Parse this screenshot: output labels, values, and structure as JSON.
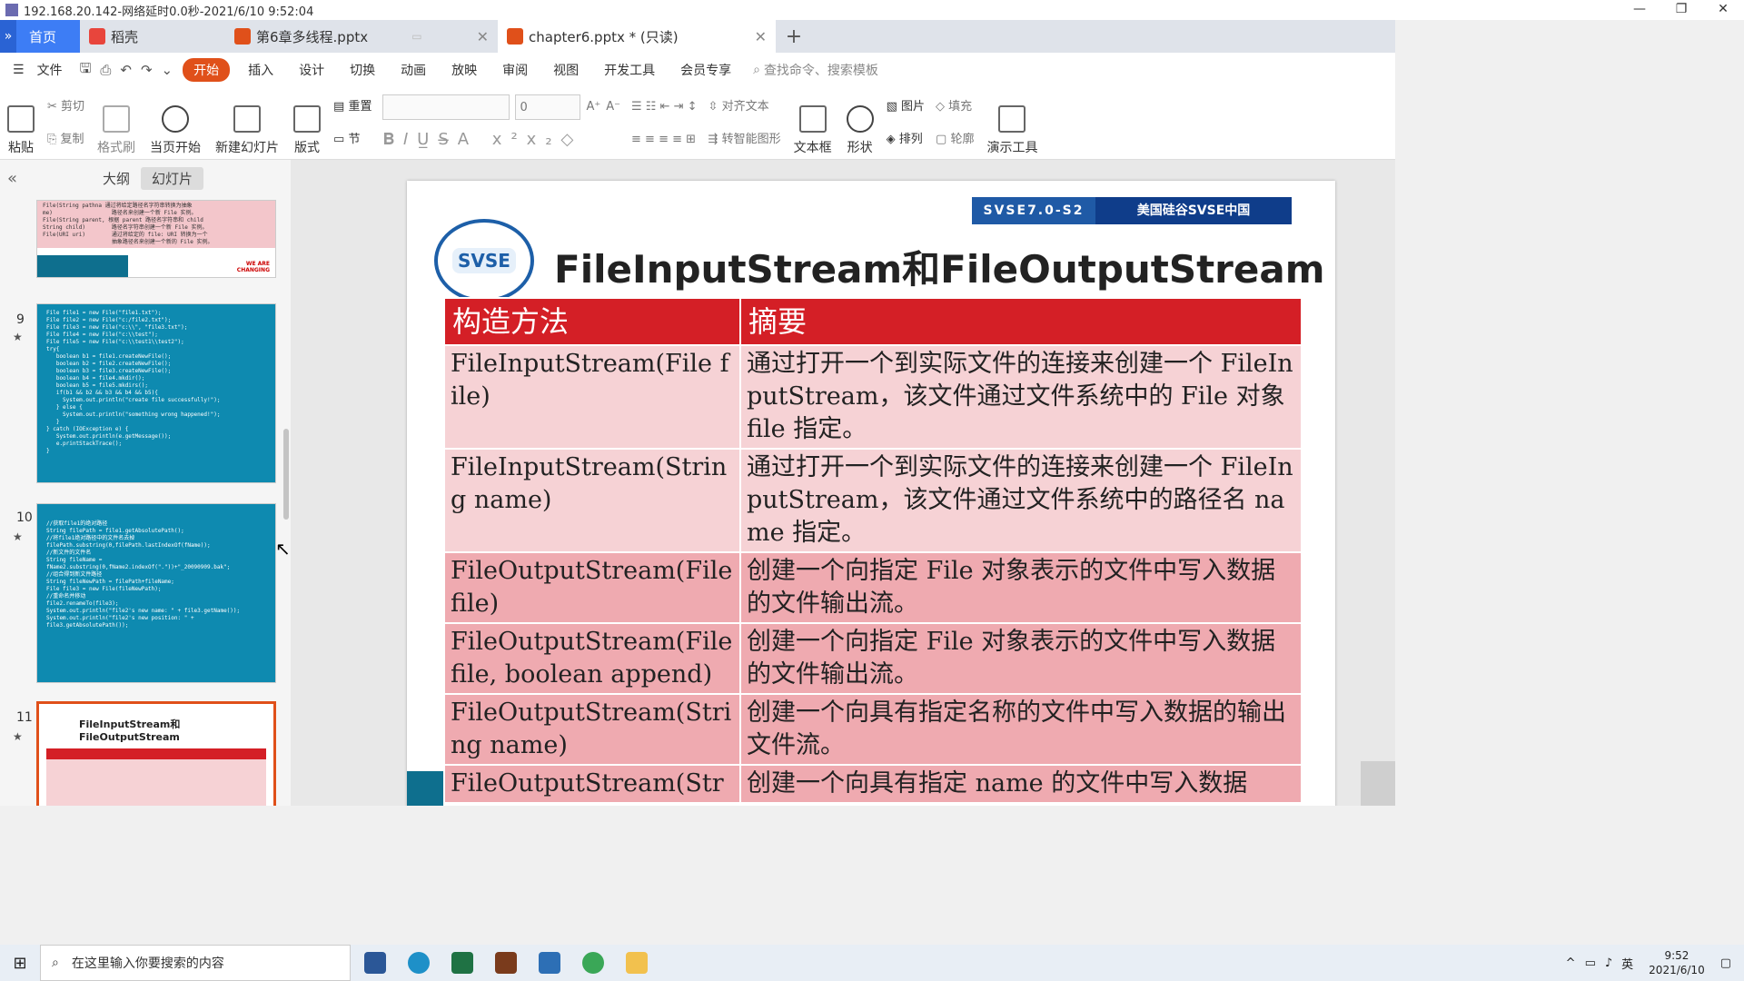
{
  "titlebar": {
    "title": "192.168.20.142-网络延时0.0秒-2021/6/10 9:52:04",
    "min": "—",
    "restore": "❐",
    "close": "✕"
  },
  "tabs": {
    "home": "首页",
    "wps": "稻壳",
    "doc1": "第6章多线程.pptx",
    "doc2": "chapter6.pptx * (只读)",
    "plus": "+"
  },
  "menu": {
    "file": "文件",
    "start": "开始",
    "insert": "插入",
    "design": "设计",
    "switch": "切换",
    "animation": "动画",
    "slideshow": "放映",
    "review": "审阅",
    "view": "视图",
    "dev": "开发工具",
    "member": "会员专享",
    "search_placeholder": "查找命令、搜索模板"
  },
  "ribbon": {
    "paste": "粘贴",
    "cut": "剪切",
    "copy": "复制",
    "format_painter": "格式刷",
    "from_current": "当页开始",
    "new_slide": "新建幻灯片",
    "layout": "版式",
    "reset": "重置",
    "section": "节",
    "font_size": "0",
    "align_text": "对齐文本",
    "smart_art": "转智能图形",
    "textbox": "文本框",
    "shape": "形状",
    "picture": "图片",
    "arrange": "排列",
    "fill": "填充",
    "outline": "轮廓",
    "present_tool": "演示工具"
  },
  "panel": {
    "collapse": "«",
    "outline_tab": "大纲",
    "slides_tab": "幻灯片",
    "thumb9_code": "File file1 = new File(\"file1.txt\");\nFile file2 = new File(\"c:/file2.txt\");\nFile file3 = new File(\"c:\\\\\", \"file3.txt\");\nFile file4 = new File(\"c:\\\\test\");\nFile file5 = new File(\"c:\\\\test1\\\\test2\");\ntry{\n   boolean b1 = file1.createNewFile();\n   boolean b2 = file2.createNewFile();\n   boolean b3 = file3.createNewFile();\n   boolean b4 = file4.mkdir();\n   boolean b5 = file5.mkdirs();\n   if(b1 && b2 && b3 && b4 && b5){\n     System.out.println(\"create file successfully!\");\n   } else {\n     System.out.println(\"something wrong happened!\");\n   }\n} catch (IOException e) {\n   System.out.println(e.getMessage());\n   e.printStackTrace();\n}",
    "thumb10_code": "//获取file1的绝对路径\nString filePath = file1.getAbsolutePath();\n//将file1绝对路径中的文件名去掉\nfilePath.substring(0,filePath.lastIndexOf(fName));\n//新文件的文件名\nString fileName =\nfName2.substring(0,fName2.indexOf(\".\"))+\"_20090909.bak\";\n//组合得到新文件路径\nString fileNewPath = filePath+fileName;\nFile file3 = new File(fileNewPath);\n//重命名并移动\nfile2.renameTo(file3);\nSystem.out.println(\"file2's new name: \" + file3.getName());\nSystem.out.println(\"file2's new position: \" +\nfile3.getAbsolutePath());",
    "thumb11_title": "FileInputStream和FileOutputStream",
    "thumb_top_code": "File(String pathna 通过将给定路径名字符串转换为抽象\nme)                  路径名来创建一个新 File 实例。\nFile(String parent, 根据 parent 路径名字符串和 child\nString child)        路径名字符串创建一个新 File 实例。\nFile(URI uri)        通过将给定的 file: URI 转换为一个\n                     抽象路径名来创建一个新的 File 实例。",
    "slide_numbers": [
      "9",
      "10",
      "11"
    ],
    "star": "★",
    "we_are_changing": "WE ARE\nCHANGING"
  },
  "slide": {
    "banner_left": "SVSE7.0-S2",
    "banner_right": "美国硅谷SVSE中国",
    "logo_text": "SVSE",
    "title": "FileInputStream和FileOutputStream",
    "table": {
      "headers": [
        "构造方法",
        "摘要"
      ],
      "rows": [
        [
          "FileInputStream(File file)",
          "通过打开一个到实际文件的连接来创建一个 FileInputStream，该文件通过文件系统中的 File 对象 file 指定。"
        ],
        [
          "FileInputStream(String name)",
          "通过打开一个到实际文件的连接来创建一个 FileInputStream，该文件通过文件系统中的路径名 name 指定。"
        ],
        [
          "FileOutputStream(File file)",
          "创建一个向指定 File 对象表示的文件中写入数据的文件输出流。"
        ],
        [
          "FileOutputStream(File file, boolean append)",
          "创建一个向指定 File 对象表示的文件中写入数据的文件输出流。"
        ],
        [
          "FileOutputStream(String name)",
          "创建一个向具有指定名称的文件中写入数据的输出文件流。"
        ],
        [
          "FileOutputStream(Str",
          "创建一个向具有指定 name 的文件中写入数据"
        ]
      ]
    }
  },
  "taskbar": {
    "search_placeholder": "在这里输入你要搜索的内容",
    "ime": "英",
    "time": "9:52",
    "date": "2021/6/10"
  },
  "colors": {
    "header_red": "#d41f26",
    "row_light": "#f6d2d5",
    "row_dark": "#efaab0",
    "accent_orange": "#e0501a",
    "home_tab_blue": "#3d7df5"
  }
}
